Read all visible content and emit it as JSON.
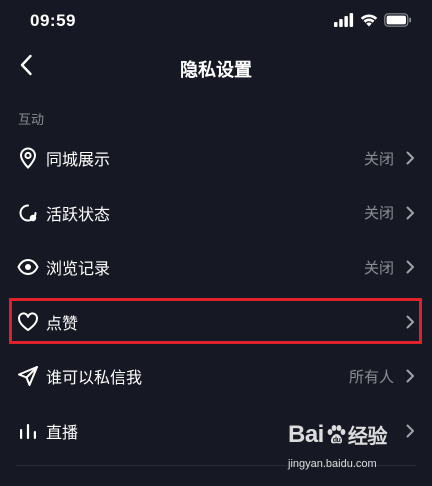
{
  "status_bar": {
    "time": "09:59"
  },
  "header": {
    "title": "隐私设置",
    "back_icon": "chevron-left-icon"
  },
  "section": {
    "title": "互动"
  },
  "rows": [
    {
      "icon": "location-pin-icon",
      "label": "同城展示",
      "value": "关闭"
    },
    {
      "icon": "activity-status-icon",
      "label": "活跃状态",
      "value": "关闭"
    },
    {
      "icon": "eye-icon",
      "label": "浏览记录",
      "value": "关闭"
    },
    {
      "icon": "heart-icon",
      "label": "点赞",
      "value": ""
    },
    {
      "icon": "send-icon",
      "label": "谁可以私信我",
      "value": "所有人"
    },
    {
      "icon": "live-bars-icon",
      "label": "直播",
      "value": ""
    }
  ],
  "highlight": {
    "color": "#e0202a",
    "target": "点赞"
  },
  "watermark": {
    "logo_left": "Bai",
    "logo_right": "经验",
    "url": "jingyan.baidu.com"
  },
  "colors": {
    "background": "#161823",
    "text_primary": "#ffffff",
    "text_secondary": "rgba(255,255,255,0.5)"
  }
}
